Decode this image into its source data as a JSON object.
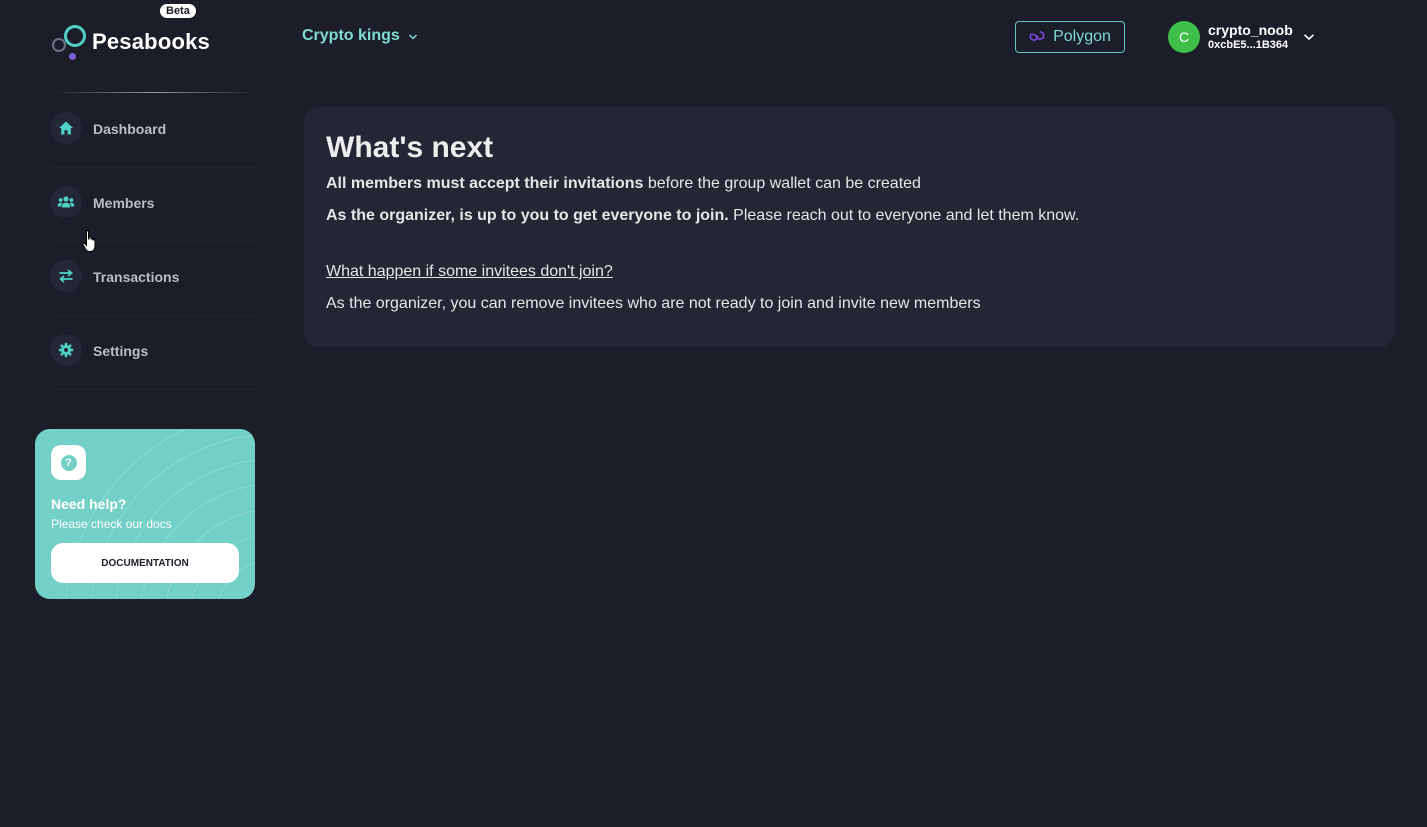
{
  "brand": {
    "name": "Pesabooks",
    "badge": "Beta"
  },
  "header": {
    "group_name": "Crypto kings",
    "network": "Polygon",
    "user": {
      "avatar_initial": "C",
      "name": "crypto_noob",
      "address": "0xcbE5...1B364"
    }
  },
  "sidebar": {
    "items": [
      {
        "label": "Dashboard",
        "icon": "home-icon"
      },
      {
        "label": "Members",
        "icon": "users-icon"
      },
      {
        "label": "Transactions",
        "icon": "arrows-exchange-icon"
      },
      {
        "label": "Settings",
        "icon": "gear-icon"
      }
    ]
  },
  "help": {
    "title": "Need help?",
    "subtitle": "Please check our docs",
    "button_label": "DOCUMENTATION",
    "icon_glyph": "?"
  },
  "main": {
    "title": "What's next",
    "line1_bold": "All members must accept their invitations",
    "line1_rest": " before the group wallet can be created",
    "line2_bold": "As the organizer, is up to you to get everyone to join.",
    "line2_rest": " Please reach out to everyone and let them know.",
    "faq_question": "What happen if some invitees don't join?",
    "faq_answer": "As the organizer, you can remove invitees who are not ready to join and invite new members"
  },
  "colors": {
    "background": "#1b1e29",
    "card": "#232733",
    "accent_teal": "#7fdad0",
    "help_card": "#72d0c6",
    "avatar": "#3fbf4a",
    "polygon_purple": "#8247e5"
  }
}
